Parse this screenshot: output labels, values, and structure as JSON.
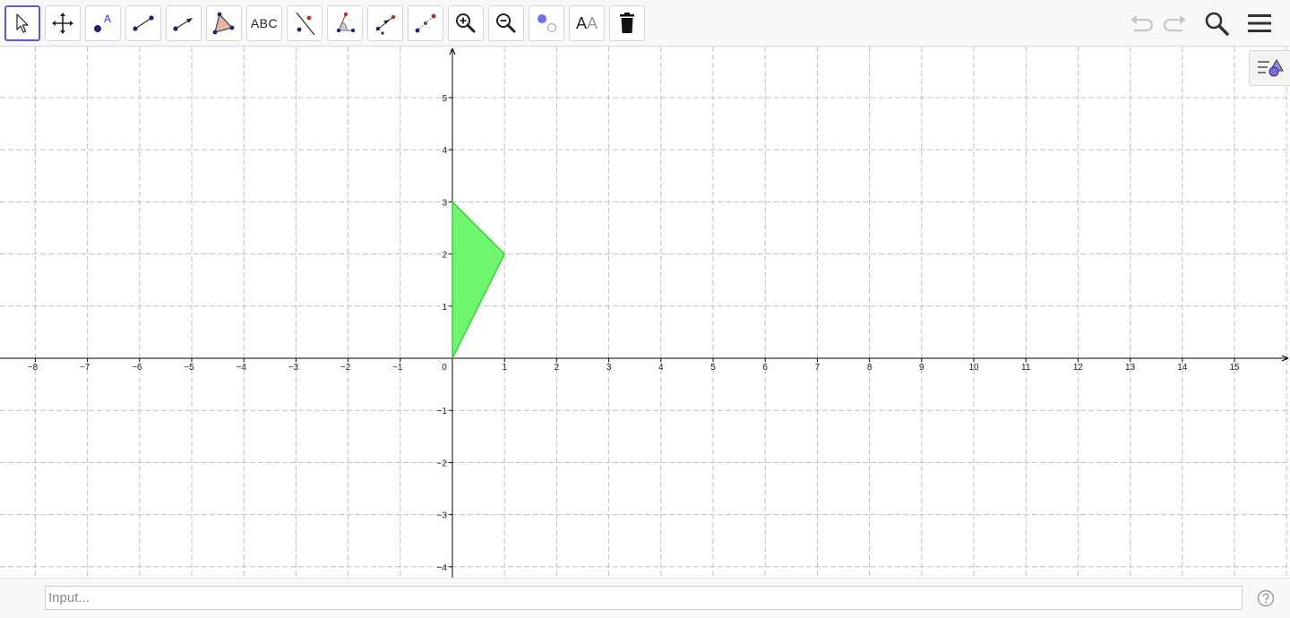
{
  "toolbar": {
    "tools": [
      {
        "name": "move",
        "icon": "cursor-arrow-icon",
        "active": true
      },
      {
        "name": "move-graphics-view",
        "icon": "move-cross-icon"
      },
      {
        "name": "point",
        "icon": "point-icon",
        "label": "A"
      },
      {
        "name": "segment",
        "icon": "segment-icon"
      },
      {
        "name": "vector",
        "icon": "vector-icon"
      },
      {
        "name": "polygon",
        "icon": "polygon-icon"
      },
      {
        "name": "text",
        "icon": "text-icon",
        "label": "ABC"
      },
      {
        "name": "line",
        "icon": "line-icon"
      },
      {
        "name": "angle",
        "icon": "angle-icon"
      },
      {
        "name": "translate-by-vector",
        "icon": "translate-vector-icon"
      },
      {
        "name": "reflect-about-point",
        "icon": "reflect-point-icon"
      },
      {
        "name": "zoom-in",
        "icon": "zoom-in-icon"
      },
      {
        "name": "zoom-out",
        "icon": "zoom-out-icon"
      },
      {
        "name": "show-hide-object",
        "icon": "show-hide-icon"
      },
      {
        "name": "show-hide-label",
        "icon": "label-icon",
        "label": "A",
        "label_small": "A"
      },
      {
        "name": "delete",
        "icon": "trash-icon"
      }
    ],
    "right": [
      "undo-icon",
      "redo-icon",
      "search-icon",
      "menu-icon"
    ]
  },
  "graphics": {
    "x_ticks": [
      "−8",
      "−7",
      "−6",
      "−5",
      "−4",
      "−3",
      "−2",
      "−1",
      "1",
      "2",
      "3",
      "4",
      "5",
      "6",
      "7",
      "8",
      "9",
      "10",
      "11",
      "12",
      "13",
      "14",
      "15"
    ],
    "y_ticks": [
      "5",
      "4",
      "3",
      "2",
      "1",
      "−1",
      "−2",
      "−3",
      "−4"
    ],
    "origin_label": "0",
    "grid": true,
    "axis_color": "#000000",
    "grid_color": "#c0c0c0",
    "polygon": {
      "vertices": [
        [
          0,
          0
        ],
        [
          0,
          3
        ],
        [
          1,
          2
        ]
      ],
      "fill": "#5ef55e",
      "stroke": "#2ecc2e"
    }
  },
  "style_bar_icon": "style-bar-toggle-icon",
  "input_bar": {
    "placeholder": "Input...",
    "value": "",
    "help_icon": "help-icon"
  }
}
